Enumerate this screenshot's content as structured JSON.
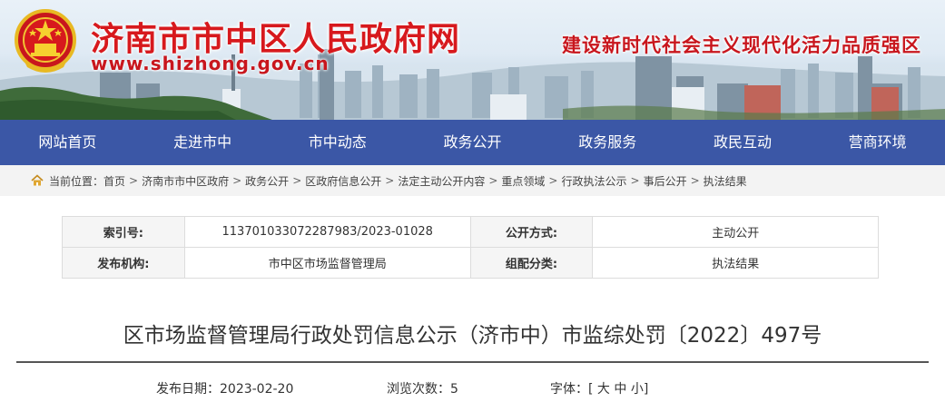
{
  "header": {
    "site_name": "济南市市中区人民政府网",
    "site_url": "www.shizhong.gov.cn",
    "slogan": "建设新时代社会主义现代化活力品质强区"
  },
  "nav": {
    "items": [
      "网站首页",
      "走进市中",
      "市中动态",
      "政务公开",
      "政务服务",
      "政民互动",
      "营商环境"
    ]
  },
  "breadcrumb": {
    "prefix": "当前位置：",
    "items": [
      "首页",
      "济南市市中区政府",
      "政务公开",
      "区政府信息公开",
      "法定主动公开内容",
      "重点领域",
      "行政执法公示",
      "事后公开",
      "执法结果"
    ],
    "separator": ">"
  },
  "info": {
    "index_label": "索引号:",
    "index_value": "113701033072287983/2023-01028",
    "method_label": "公开方式:",
    "method_value": "主动公开",
    "publisher_label": "发布机构:",
    "publisher_value": "市中区市场监督管理局",
    "category_label": "组配分类:",
    "category_value": "执法结果"
  },
  "article": {
    "title": "区市场监督管理局行政处罚信息公示（济市中）市监综处罚〔2022〕497号",
    "date_label": "发布日期：",
    "date_value": "2023-02-20",
    "views_label": "浏览次数：",
    "views_value": "5",
    "font_label": "字体：",
    "font_open": "[",
    "font_large": "大",
    "font_medium": "中",
    "font_small": "小",
    "font_close": "]"
  },
  "colors": {
    "nav_bg": "#3b57a6",
    "brand_red": "#d7191d",
    "crumb_bg": "#f3f3f3"
  }
}
